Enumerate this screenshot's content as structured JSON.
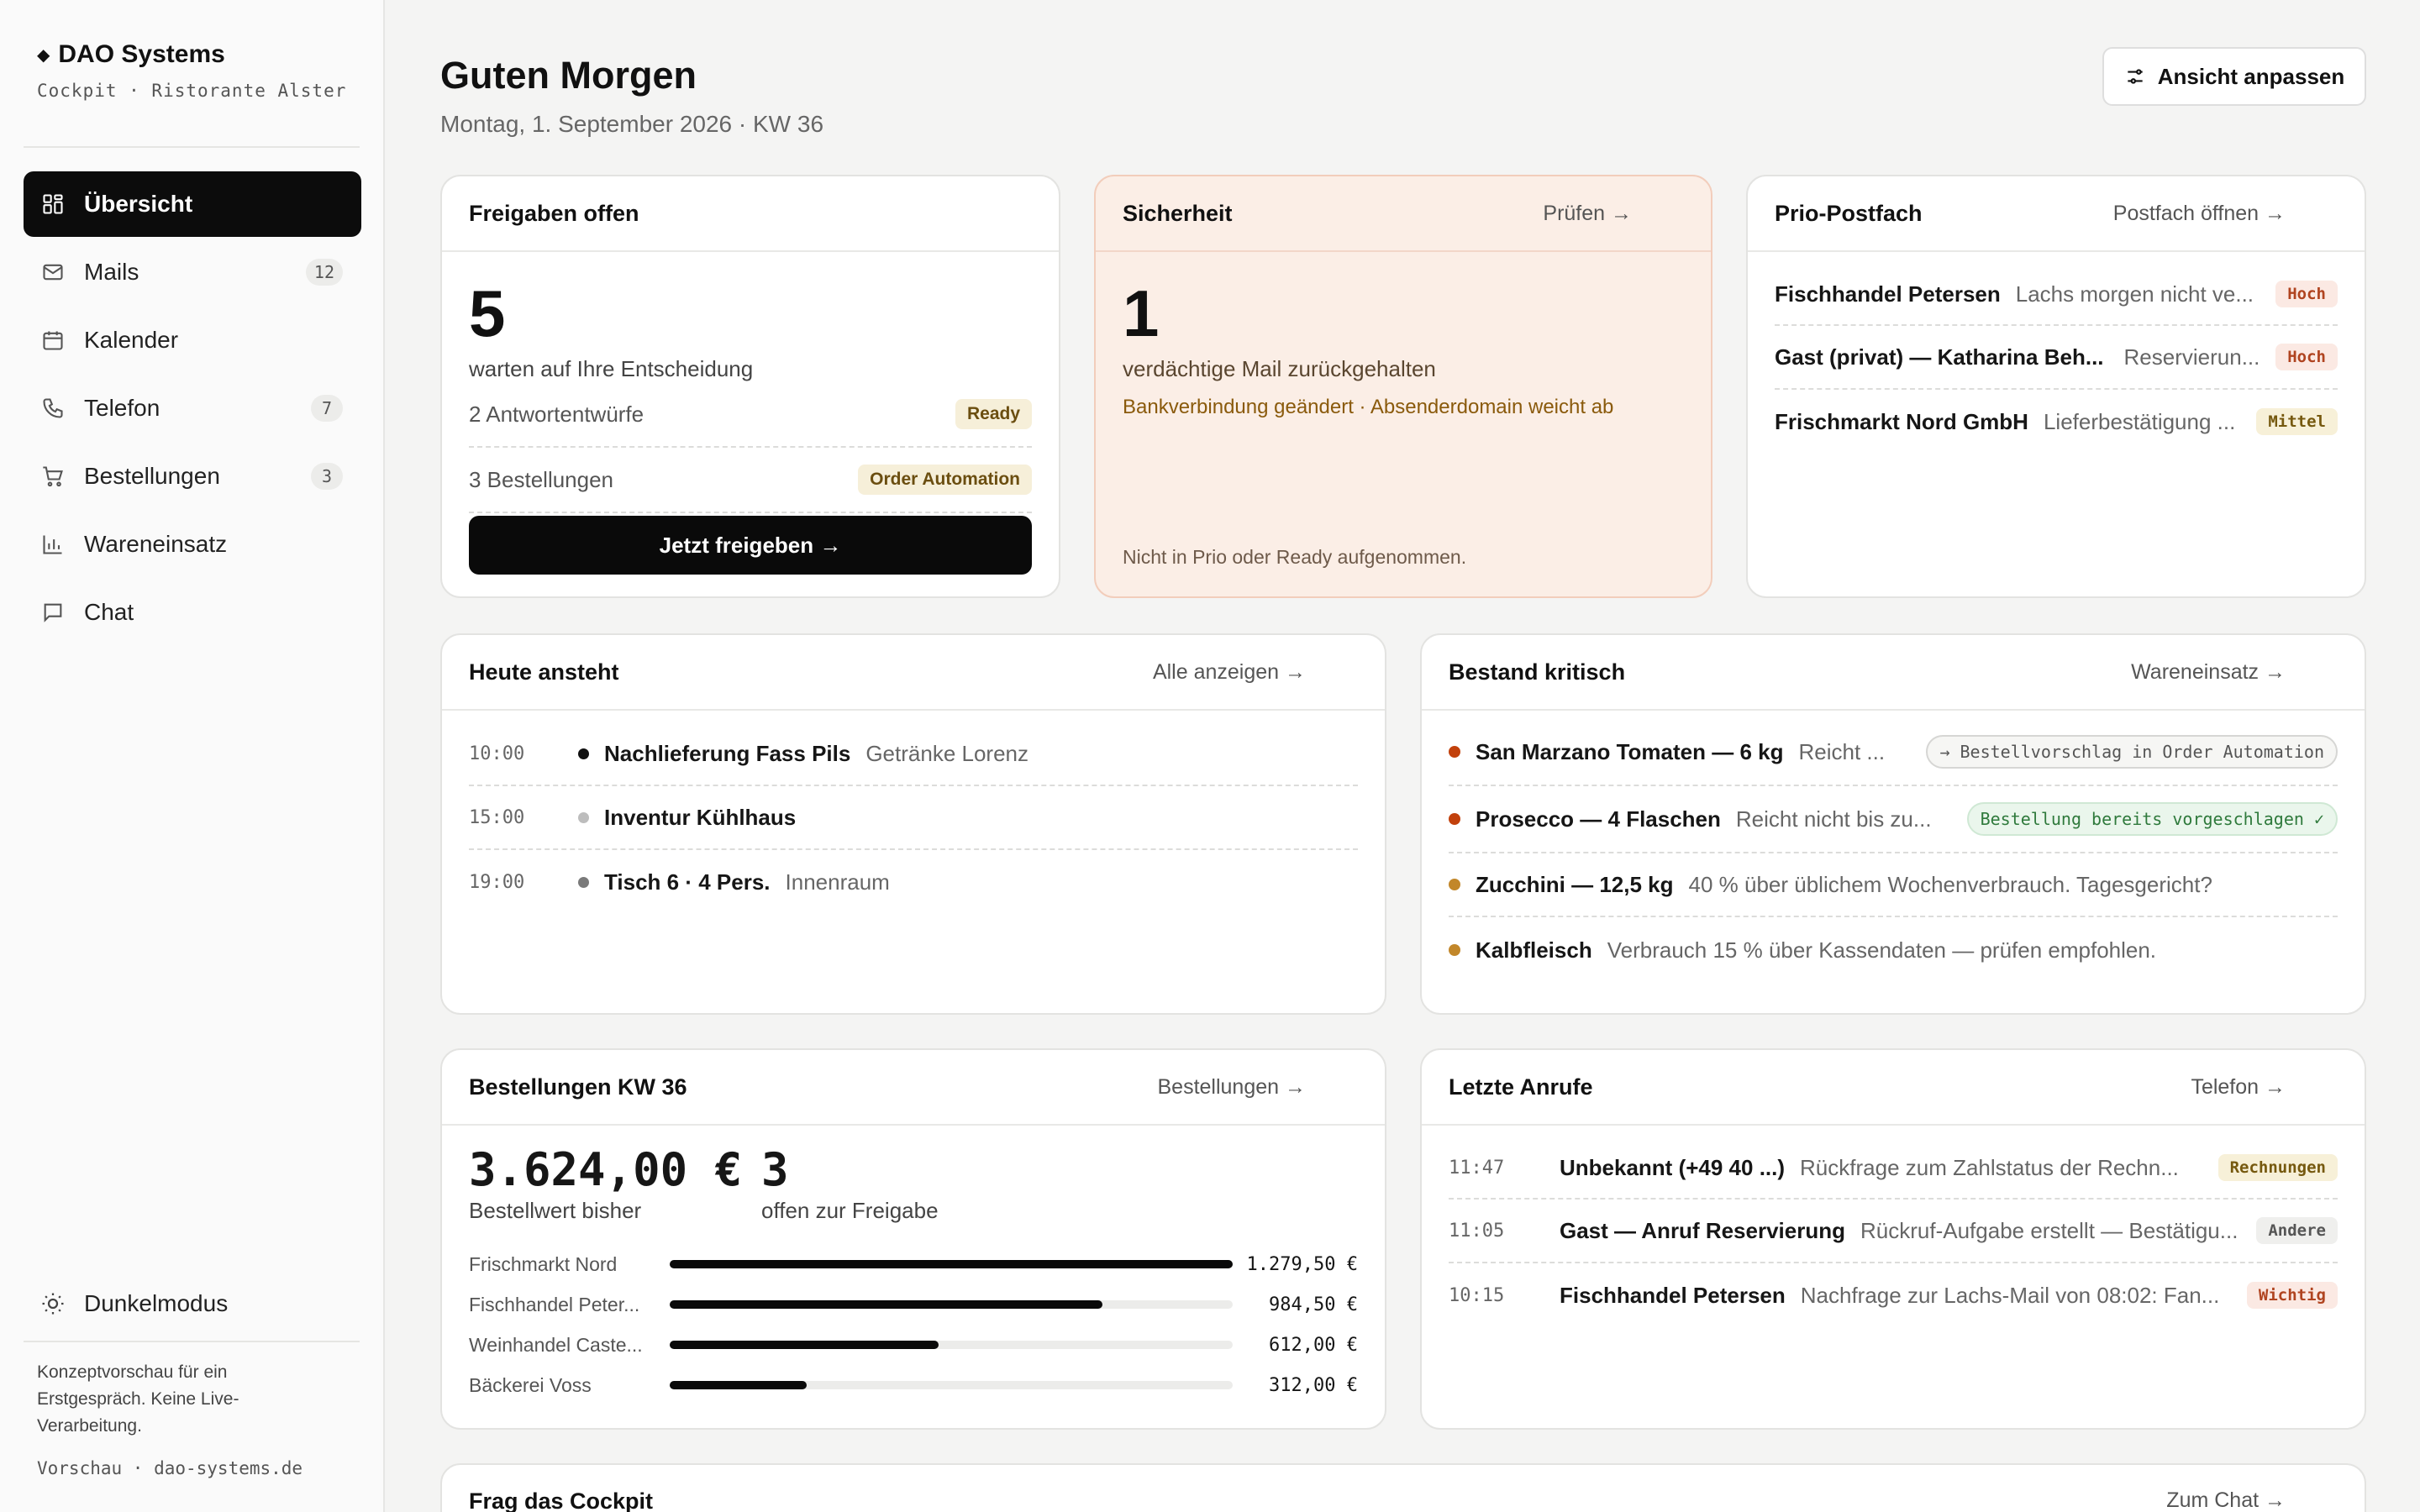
{
  "brand": {
    "name": "DAO Systems",
    "subtitle": "Cockpit · Ristorante Alster"
  },
  "nav": [
    {
      "label": "Übersicht",
      "icon": "grid-icon",
      "badge": "",
      "active": true
    },
    {
      "label": "Mails",
      "icon": "mail-icon",
      "badge": "12"
    },
    {
      "label": "Kalender",
      "icon": "calendar-icon",
      "badge": ""
    },
    {
      "label": "Telefon",
      "icon": "phone-icon",
      "badge": "7"
    },
    {
      "label": "Bestellungen",
      "icon": "cart-icon",
      "badge": "3"
    },
    {
      "label": "Wareneinsatz",
      "icon": "bar-chart-icon",
      "badge": ""
    },
    {
      "label": "Chat",
      "icon": "chat-icon",
      "badge": ""
    }
  ],
  "sidebar_footer": {
    "dark_mode": "Dunkelmodus",
    "note": "Konzeptvorschau für ein Erstgespräch. Keine Live-Verarbeitung.",
    "preview": "Vorschau · dao-systems.de"
  },
  "header": {
    "greeting": "Guten Morgen",
    "date": "Montag, 1. September 2026 · KW 36",
    "customize": "Ansicht anpassen"
  },
  "approvals": {
    "title": "Freigaben offen",
    "count": "5",
    "count_label": "warten auf Ihre Entscheidung",
    "rows": [
      {
        "label": "2 Antwortentwürfe",
        "tag": "Ready"
      },
      {
        "label": "3 Bestellungen",
        "tag": "Order Automation"
      }
    ],
    "button": "Jetzt freigeben →"
  },
  "security": {
    "title": "Sicherheit",
    "link": "Prüfen →",
    "count": "1",
    "count_label": "verdächtige Mail zurückgehalten",
    "detail": "Bankverbindung geändert · Absenderdomain weicht ab",
    "note": "Nicht in Prio oder Ready aufgenommen."
  },
  "inbox": {
    "title": "Prio-Postfach",
    "link": "Postfach öffnen →",
    "items": [
      {
        "sender": "Fischhandel Petersen",
        "subject": "Lachs morgen nicht ve...",
        "tag": "Hoch",
        "level": "hoch"
      },
      {
        "sender": "Gast (privat) — Katharina Beh...",
        "subject": "Reservierun...",
        "tag": "Hoch",
        "level": "hoch"
      },
      {
        "sender": "Frischmarkt Nord GmbH",
        "subject": "Lieferbestätigung ...",
        "tag": "Mittel",
        "level": "mittel"
      }
    ]
  },
  "today": {
    "title": "Heute ansteht",
    "link": "Alle anzeigen →",
    "items": [
      {
        "time": "10:00",
        "title": "Nachlieferung Fass Pils",
        "detail": "Getränke Lorenz",
        "dot": "#111111"
      },
      {
        "time": "15:00",
        "title": "Inventur Kühlhaus",
        "detail": "",
        "dot": "#bdbdbd"
      },
      {
        "time": "19:00",
        "title": "Tisch 6 · 4 Pers.",
        "detail": "Innenraum",
        "dot": "#7a7a7a"
      }
    ]
  },
  "stock": {
    "title": "Bestand kritisch",
    "link": "Wareneinsatz →",
    "items": [
      {
        "title": "San Marzano Tomaten — 6 kg",
        "detail": "Reicht ...",
        "tag": "→ Bestellvorschlag in Order Automation",
        "tag_style": "outline",
        "dot": "#c2410c"
      },
      {
        "title": "Prosecco — 4 Flaschen",
        "detail": "Reicht nicht bis zu...",
        "tag": "Bestellung bereits vorgeschlagen ✓",
        "tag_style": "green",
        "dot": "#c2410c"
      },
      {
        "title": "Zucchini — 12,5 kg",
        "detail": "40 % über üblichem Wochenverbrauch. Tagesgericht?",
        "tag": "",
        "dot": "#c2872a"
      },
      {
        "title": "Kalbfleisch",
        "detail": "Verbrauch 15 % über Kassendaten — prüfen empfohlen.",
        "tag": "",
        "dot": "#c2872a"
      }
    ]
  },
  "orders": {
    "title": "Bestellungen KW 36",
    "link": "Bestellungen →",
    "total": "3.624,00 €",
    "total_label": "Bestellwert bisher",
    "open": "3",
    "open_label": "offen zur Freigabe",
    "suppliers": [
      {
        "name": "Frischmarkt Nord",
        "amount": "1.279,50 €",
        "value": 1279.5
      },
      {
        "name": "Fischhandel Peter...",
        "amount": "984,50 €",
        "value": 984.5
      },
      {
        "name": "Weinhandel Caste...",
        "amount": "612,00 €",
        "value": 612.0
      },
      {
        "name": "Bäckerei Voss",
        "amount": "312,00 €",
        "value": 312.0
      }
    ],
    "max": 1279.5
  },
  "calls": {
    "title": "Letzte Anrufe",
    "link": "Telefon →",
    "items": [
      {
        "time": "11:47",
        "caller": "Unbekannt (+49 40 ...)",
        "detail": "Rückfrage zum Zahlstatus der Rechn...",
        "tag": "Rechnungen",
        "style": "mittel"
      },
      {
        "time": "11:05",
        "caller": "Gast — Anruf Reservierung",
        "detail": "Rückruf-Aufgabe erstellt — Bestätigu...",
        "tag": "Andere",
        "style": "grey"
      },
      {
        "time": "10:15",
        "caller": "Fischhandel Petersen",
        "detail": "Nachfrage zur Lachs-Mail von 08:02: Fan...",
        "tag": "Wichtig",
        "style": "hoch"
      }
    ]
  },
  "ask": {
    "title": "Frag das Cockpit",
    "link": "Zum Chat →"
  }
}
